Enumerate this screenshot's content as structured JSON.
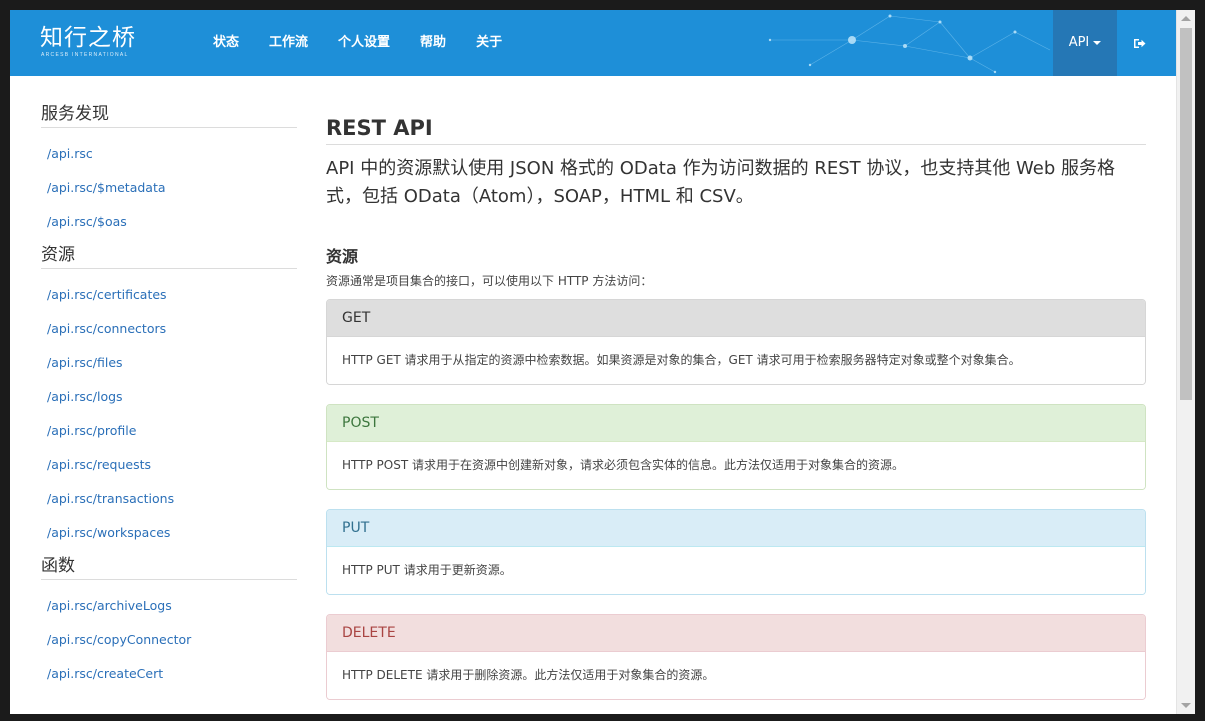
{
  "brand": {
    "name": "知行之桥",
    "subtitle": "ARCESB INTERNATIONAL"
  },
  "nav": {
    "items": [
      "状态",
      "工作流",
      "个人设置",
      "帮助",
      "关于"
    ],
    "api_label": "API",
    "logout_icon": "sign-out-icon"
  },
  "sidebar": {
    "sections": [
      {
        "heading": "服务发现",
        "links": [
          "/api.rsc",
          "/api.rsc/$metadata",
          "/api.rsc/$oas"
        ]
      },
      {
        "heading": "资源",
        "links": [
          "/api.rsc/certificates",
          "/api.rsc/connectors",
          "/api.rsc/files",
          "/api.rsc/logs",
          "/api.rsc/profile",
          "/api.rsc/requests",
          "/api.rsc/transactions",
          "/api.rsc/workspaces"
        ]
      },
      {
        "heading": "函数",
        "links": [
          "/api.rsc/archiveLogs",
          "/api.rsc/copyConnector",
          "/api.rsc/createCert"
        ]
      }
    ]
  },
  "main": {
    "title": "REST API",
    "lead": "API 中的资源默认使用 JSON 格式的 OData 作为访问数据的 REST 协议，也支持其他 Web 服务格式，包括 OData（Atom），SOAP，HTML 和 CSV。",
    "resources_heading": "资源",
    "resources_desc": "资源通常是项目集合的接口，可以使用以下 HTTP 方法访问：",
    "methods": [
      {
        "name": "GET",
        "desc": "HTTP GET 请求用于从指定的资源中检索数据。如果资源是对象的集合，GET 请求可用于检索服务器特定对象或整个对象集合。"
      },
      {
        "name": "POST",
        "desc": "HTTP POST 请求用于在资源中创建新对象，请求必须包含实体的信息。此方法仅适用于对象集合的资源。"
      },
      {
        "name": "PUT",
        "desc": "HTTP PUT 请求用于更新资源。"
      },
      {
        "name": "DELETE",
        "desc": "HTTP DELETE 请求用于删除资源。此方法仅适用于对象集合的资源。"
      }
    ]
  },
  "colors": {
    "navbar": "#1e8fd8",
    "link": "#2a6fb8",
    "get": "#dedede",
    "post": "#dff0d8",
    "put": "#d9edf7",
    "delete": "#f2dede"
  }
}
